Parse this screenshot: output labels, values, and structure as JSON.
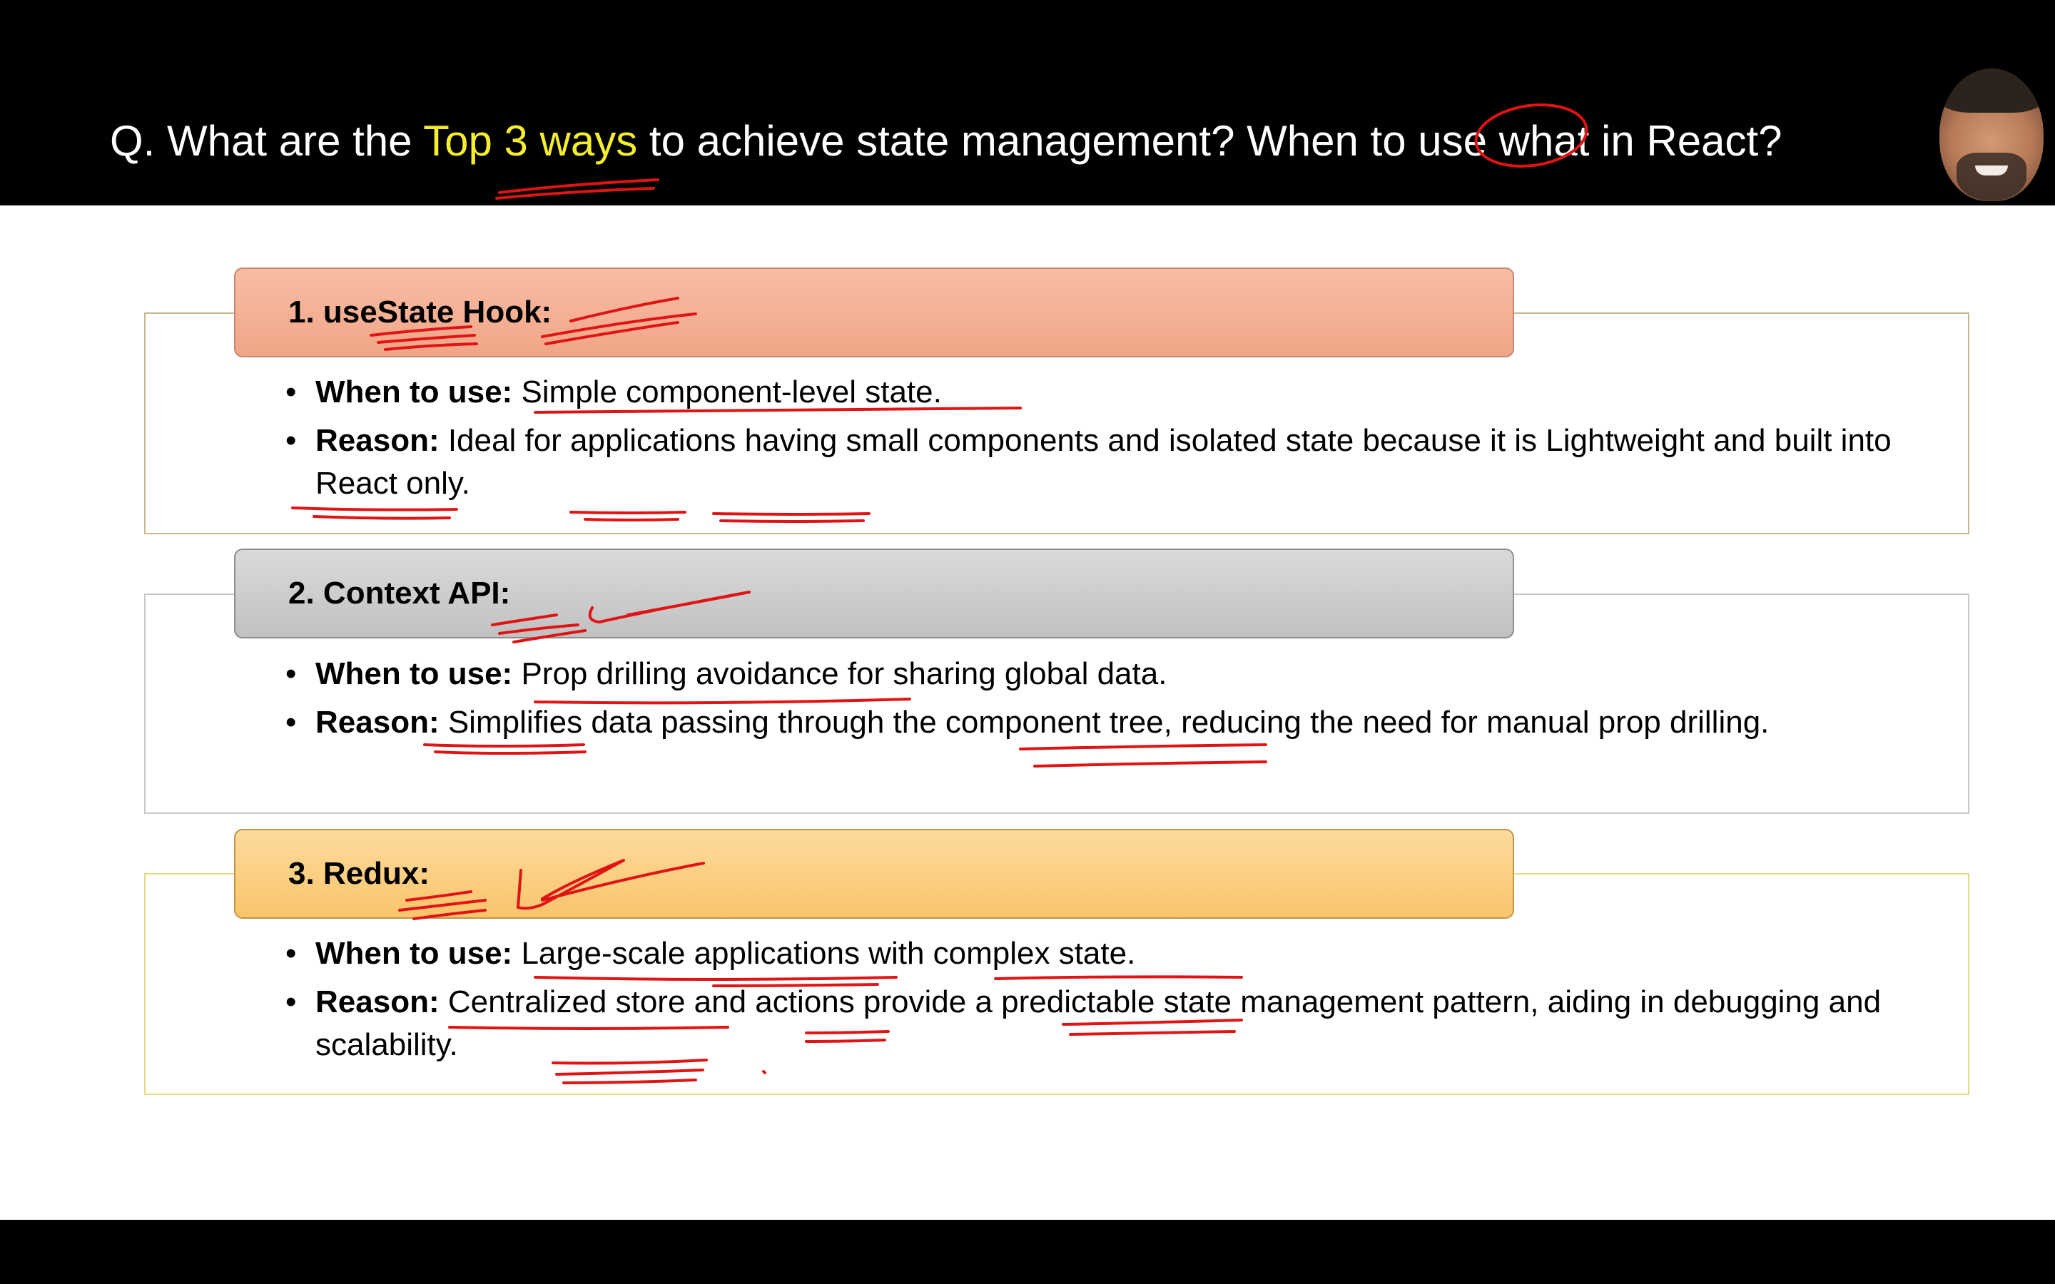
{
  "title": {
    "pre": "Q. What are the ",
    "highlight": "Top 3 ways",
    "post": " to achieve state management? When to use what in React?"
  },
  "colors": {
    "title_highlight": "#f5ee2c",
    "annotation_ink": "#e01414",
    "usestate_header": "#f3aa8c",
    "context_header": "#c9c9c9",
    "redux_header": "#fbd083"
  },
  "sections": [
    {
      "heading": "1. useState Hook:",
      "bullets": [
        {
          "label": "When to use:",
          "text": "Simple component-level state."
        },
        {
          "label": "Reason:",
          "text": "Ideal for applications having small components and isolated state because it is Lightweight and built into React only."
        }
      ]
    },
    {
      "heading": "2. Context API:",
      "bullets": [
        {
          "label": "When to use:",
          "text": "Prop drilling avoidance for sharing global data."
        },
        {
          "label": "Reason:",
          "text": "Simplifies data passing through the component tree, reducing the need for manual prop drilling."
        }
      ]
    },
    {
      "heading": "3. Redux:",
      "bullets": [
        {
          "label": "When to use:",
          "text": "Large-scale applications with complex state."
        },
        {
          "label": "Reason:",
          "text": "Centralized store and actions provide a predictable state management pattern, aiding in debugging and scalability."
        }
      ]
    }
  ],
  "presenter": {
    "icon": "presenter-avatar-icon"
  }
}
